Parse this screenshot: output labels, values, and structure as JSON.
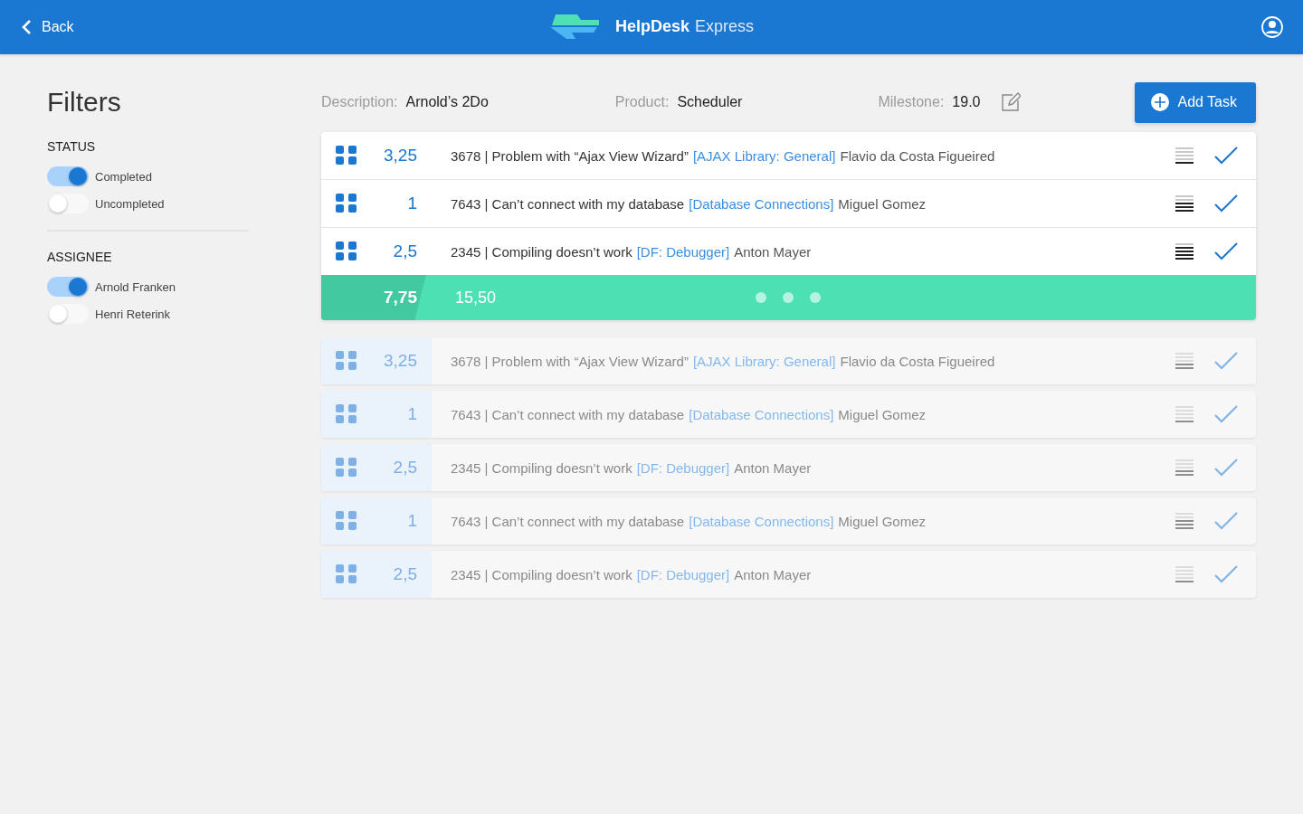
{
  "header": {
    "back": "Back",
    "brand_bold": "HelpDesk",
    "brand_light": "Express"
  },
  "filters": {
    "title": "Filters",
    "sections": [
      {
        "heading": "STATUS",
        "options": [
          {
            "label": "Completed",
            "on": true
          },
          {
            "label": "Uncompleted",
            "on": false
          }
        ]
      },
      {
        "heading": "ASSIGNEE",
        "options": [
          {
            "label": "Arnold Franken",
            "on": true
          },
          {
            "label": "Henri Reterink",
            "on": false
          }
        ]
      }
    ]
  },
  "info": {
    "fields": [
      {
        "label": "Description:",
        "value": "Arnold’s 2Do"
      },
      {
        "label": "Product:",
        "value": "Scheduler"
      },
      {
        "label": "Milestone:",
        "value": "19.0"
      }
    ],
    "add_button": "Add Task"
  },
  "task_groups": [
    {
      "faded": false,
      "rows": [
        {
          "hours": "3,25",
          "title": "3678 | Problem with “Ajax View Wizard”",
          "category": "[AJAX Library: General]",
          "assignee": "Flavio da Costa Figueired",
          "level": 0.2
        },
        {
          "hours": "1",
          "title": "7643 | Can’t connect with my database",
          "category": "[Database Connections]",
          "assignee": "Miguel Gomez",
          "level": 0.6
        },
        {
          "hours": "2,5",
          "title": "2345 | Compiling doesn’t work",
          "category": "[DF: Debugger]",
          "assignee": "Anton Mayer",
          "level": 0.8
        }
      ],
      "summary": {
        "total": "7,75",
        "sum": "15,50"
      }
    },
    {
      "faded": true,
      "rows": [
        {
          "hours": "3,25",
          "title": "3678 | Problem with “Ajax View Wizard”",
          "category": "[AJAX Library: General]",
          "assignee": "Flavio da Costa Figueired",
          "level": 0.4
        },
        {
          "hours": "1",
          "title": "7643 | Can’t connect with my database",
          "category": "[Database Connections]",
          "assignee": "Miguel Gomez",
          "level": 0.2
        },
        {
          "hours": "2,5",
          "title": "2345 | Compiling doesn’t work",
          "category": "[DF: Debugger]",
          "assignee": "Anton Mayer",
          "level": 0.4
        },
        {
          "hours": "1",
          "title": "7643 | Can’t connect with my database",
          "category": "[Database Connections]",
          "assignee": "Miguel Gomez",
          "level": 0.6
        },
        {
          "hours": "2,5",
          "title": "2345 | Compiling doesn’t work",
          "category": "[DF: Debugger]",
          "assignee": "Anton Mayer",
          "level": 0.2
        }
      ]
    }
  ]
}
